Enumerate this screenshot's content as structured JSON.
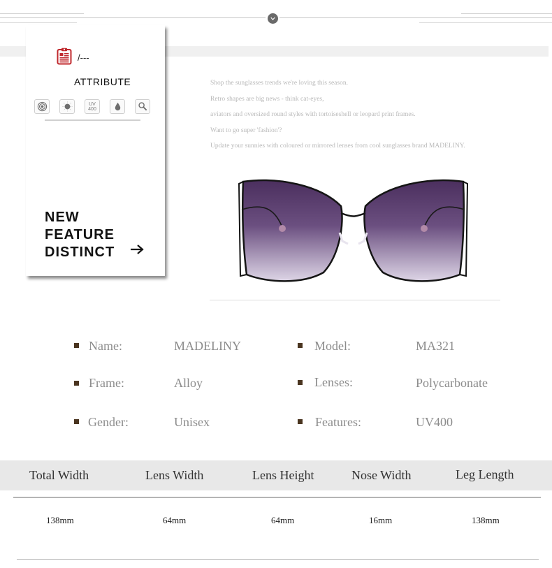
{
  "header": {
    "scroll_icon": "chevron-down-circle-icon"
  },
  "card": {
    "header_icon": "clipboard-icon",
    "header_text": "/---",
    "title": "ATTRIBUTE",
    "icons": [
      {
        "name": "polarized-target-icon"
      },
      {
        "name": "sun-icon"
      },
      {
        "name": "uv400-icon",
        "line1": "UV",
        "line2": "400"
      },
      {
        "name": "water-drop-icon"
      },
      {
        "name": "magnifier-icon"
      }
    ],
    "feature_lines": [
      "NEW",
      "FEATURE",
      "DISTINCT"
    ],
    "arrow_icon": "arrow-right-icon"
  },
  "description": [
    "Shop the sunglasses trends we're loving this season.",
    "Retro shapes are big news - think cat-eyes,",
    "aviators and oversized round styles with tortoiseshell or leopard print frames.",
    "Want to go super 'fashion'?",
    "Update your sunnies with coloured or mirrored lenses from cool sunglasses brand MADELINY."
  ],
  "product": {
    "image_desc": "purple gradient cat-eye oversized sunglasses with black metal frame",
    "lens_color_top": "#4b2f5e",
    "lens_color_bottom": "#d8cfe2"
  },
  "specs": [
    {
      "label": "Name:",
      "value": "MADELINY"
    },
    {
      "label": "Model:",
      "value": "MA321"
    },
    {
      "label": "Frame:",
      "value": "Alloy"
    },
    {
      "label": "Lenses:",
      "value": "Polycarbonate"
    },
    {
      "label": "Gender:",
      "value": "Unisex"
    },
    {
      "label": "Features:",
      "value": "UV400"
    }
  ],
  "dimensions": {
    "headers": [
      "Total Width",
      "Lens Width",
      "Lens Height",
      "Nose Width",
      "Leg Length"
    ],
    "values": [
      "138mm",
      "64mm",
      "64mm",
      "16mm",
      "138mm"
    ]
  },
  "colors": {
    "bullet": "#4a3520",
    "accent_red": "#c0282d"
  }
}
